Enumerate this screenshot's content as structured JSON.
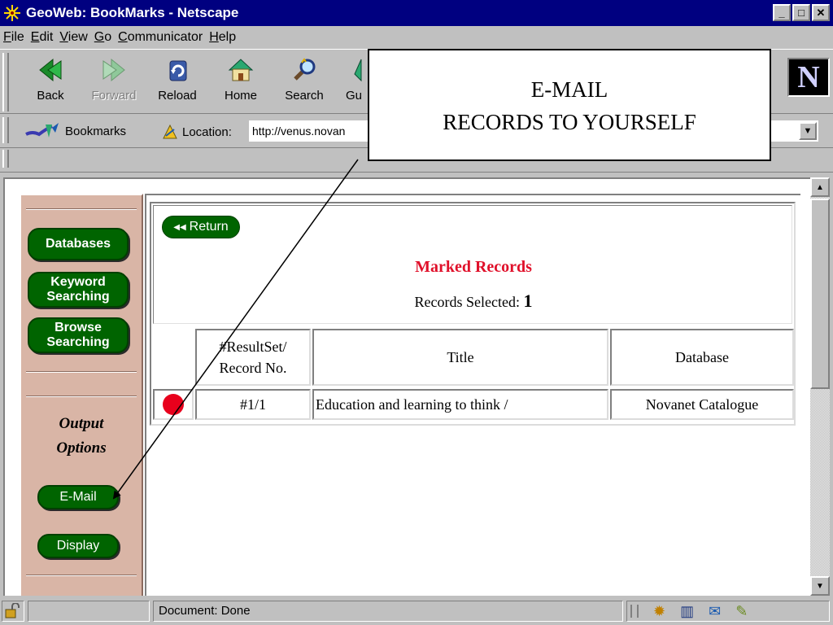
{
  "window": {
    "title": "GeoWeb: BookMarks - Netscape",
    "controls": {
      "minimize": "_",
      "maximize": "□",
      "close": "✕"
    }
  },
  "menubar": {
    "items": [
      {
        "label": "File",
        "underline": "F"
      },
      {
        "label": "Edit",
        "underline": "E"
      },
      {
        "label": "View",
        "underline": "V"
      },
      {
        "label": "Go",
        "underline": "G"
      },
      {
        "label": "Communicator",
        "underline": "C"
      },
      {
        "label": "Help",
        "underline": "H"
      }
    ]
  },
  "toolbar": {
    "back": "Back",
    "forward": "Forward",
    "reload": "Reload",
    "home": "Home",
    "search": "Search",
    "guide": "Gu",
    "logo": "N"
  },
  "locationbar": {
    "bookmarks_label": "Bookmarks",
    "location_label": "Location:",
    "url": "http://venus.novan"
  },
  "sidebar": {
    "databases": "Databases",
    "keyword_1": "Keyword",
    "keyword_2": "Searching",
    "browse_1": "Browse",
    "browse_2": "Searching",
    "output_1": "Output",
    "output_2": "Options",
    "email": "E-Mail",
    "display": "Display"
  },
  "main": {
    "return_label": "Return",
    "title": "Marked Records",
    "records_selected_label": "Records Selected:",
    "records_selected_count": "1",
    "columns": {
      "record_no_1": "#ResultSet/",
      "record_no_2": "Record No.",
      "title": "Title",
      "database": "Database"
    },
    "rows": [
      {
        "record_no": "#1/1",
        "title": "Education and learning to think /",
        "database": "Novanet Catalogue"
      }
    ]
  },
  "statusbar": {
    "text": "Document: Done"
  },
  "callout": {
    "line1": "E-MAIL",
    "line2": "RECORDS TO YOURSELF"
  },
  "colors": {
    "titlebar": "#000080",
    "nav_button": "#006400",
    "marked_title": "#e0102a",
    "sidebar_bg": "#d9b5a6",
    "record_marker": "#e8001c"
  }
}
